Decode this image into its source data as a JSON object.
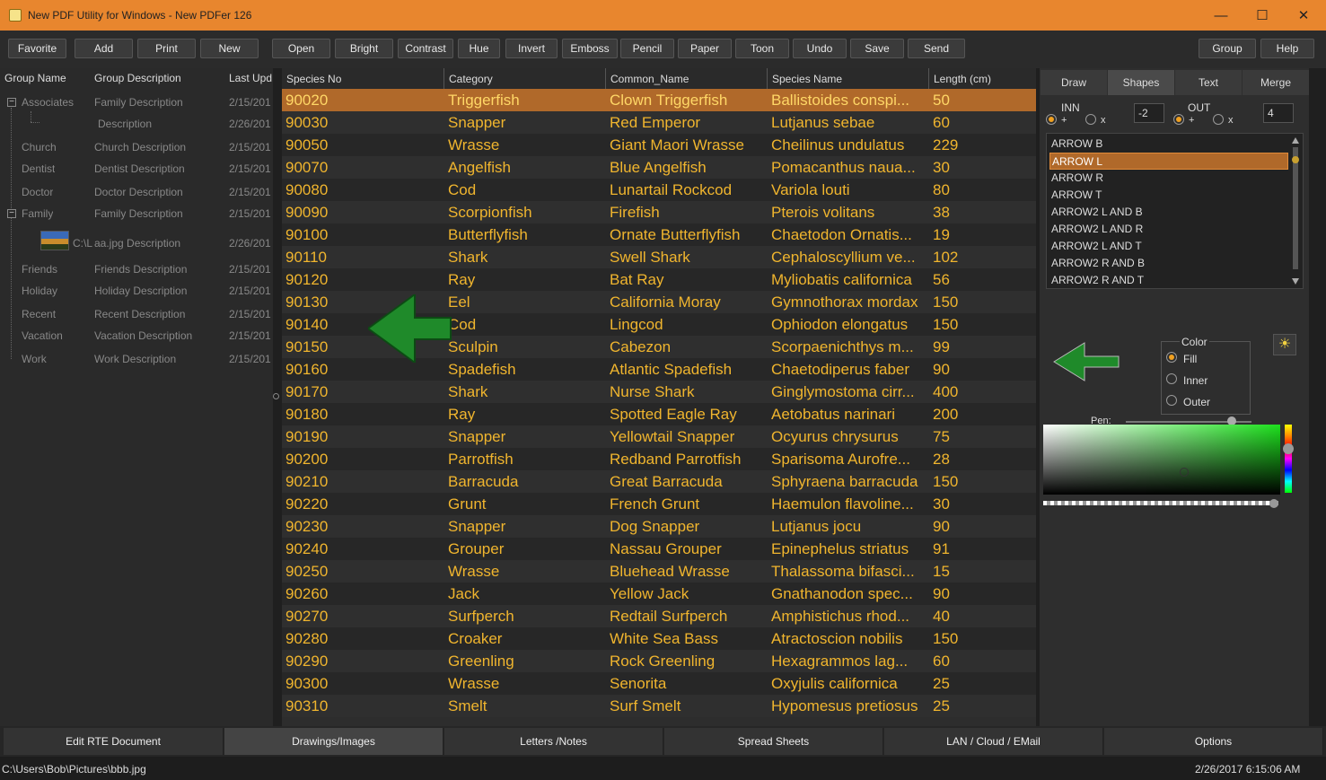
{
  "window": {
    "title": "New PDF Utility for Windows - New PDFer 126"
  },
  "toolbar": {
    "buttons": [
      "Favorite",
      "Add",
      "Print",
      "New",
      "Open",
      "Bright",
      "Contrast",
      "Hue",
      "Invert",
      "Emboss",
      "Pencil",
      "Paper",
      "Toon",
      "Undo",
      "Save",
      "Send"
    ],
    "right_buttons": [
      "Group",
      "Help"
    ]
  },
  "groups": {
    "headers": [
      "Group Name",
      "Group Description",
      "Last Upd"
    ],
    "rows": [
      {
        "name": "Associates",
        "desc": "Family Description",
        "date": "2/15/201"
      },
      {
        "name": "",
        "desc": "Description",
        "date": "2/26/201"
      },
      {
        "name": "Church",
        "desc": "Church Description",
        "date": "2/15/201"
      },
      {
        "name": "Dentist",
        "desc": "Dentist Description",
        "date": "2/15/201"
      },
      {
        "name": "Doctor",
        "desc": "Doctor Description",
        "date": "2/15/201"
      },
      {
        "name": "Family",
        "desc": "Family Description",
        "date": "2/15/201"
      },
      {
        "name": "C:\\L",
        "desc": "aa.jpg Description",
        "date": "2/26/201"
      },
      {
        "name": "Friends",
        "desc": "Friends Description",
        "date": "2/15/201"
      },
      {
        "name": "Holiday",
        "desc": "Holiday Description",
        "date": "2/15/201"
      },
      {
        "name": "Recent",
        "desc": "Recent Description",
        "date": "2/15/201"
      },
      {
        "name": "Vacation",
        "desc": "Vacation Description",
        "date": "2/15/201"
      },
      {
        "name": "Work",
        "desc": "Work Description",
        "date": "2/15/201"
      }
    ]
  },
  "grid": {
    "headers": [
      "Species No",
      "Category",
      "Common_Name",
      "Species Name",
      "Length (cm)"
    ],
    "rows": [
      [
        "90020",
        "Triggerfish",
        "Clown Triggerfish",
        "Ballistoides conspi...",
        "50"
      ],
      [
        "90030",
        "Snapper",
        "Red Emperor",
        "Lutjanus sebae",
        "60"
      ],
      [
        "90050",
        "Wrasse",
        "Giant Maori Wrasse",
        "Cheilinus undulatus",
        "229"
      ],
      [
        "90070",
        "Angelfish",
        "Blue Angelfish",
        "Pomacanthus naua...",
        "30"
      ],
      [
        "90080",
        "Cod",
        "Lunartail Rockcod",
        "Variola louti",
        "80"
      ],
      [
        "90090",
        "Scorpionfish",
        "Firefish",
        "Pterois volitans",
        "38"
      ],
      [
        "90100",
        "Butterflyfish",
        "Ornate Butterflyfish",
        "Chaetodon Ornatis...",
        "19"
      ],
      [
        "90110",
        "Shark",
        "Swell Shark",
        "Cephaloscyllium ve...",
        "102"
      ],
      [
        "90120",
        "Ray",
        "Bat Ray",
        "Myliobatis californica",
        "56"
      ],
      [
        "90130",
        "Eel",
        "California Moray",
        "Gymnothorax mordax",
        "150"
      ],
      [
        "90140",
        "Cod",
        "Lingcod",
        "Ophiodon elongatus",
        "150"
      ],
      [
        "90150",
        "Sculpin",
        "Cabezon",
        "Scorpaenichthys m...",
        "99"
      ],
      [
        "90160",
        "Spadefish",
        "Atlantic Spadefish",
        "Chaetodiperus faber",
        "90"
      ],
      [
        "90170",
        "Shark",
        "Nurse Shark",
        "Ginglymostoma cirr...",
        "400"
      ],
      [
        "90180",
        "Ray",
        "Spotted Eagle Ray",
        "Aetobatus narinari",
        "200"
      ],
      [
        "90190",
        "Snapper",
        "Yellowtail Snapper",
        "Ocyurus chrysurus",
        "75"
      ],
      [
        "90200",
        "Parrotfish",
        "Redband Parrotfish",
        "Sparisoma Aurofre...",
        "28"
      ],
      [
        "90210",
        "Barracuda",
        "Great Barracuda",
        "Sphyraena barracuda",
        "150"
      ],
      [
        "90220",
        "Grunt",
        "French Grunt",
        "Haemulon flavoline...",
        "30"
      ],
      [
        "90230",
        "Snapper",
        "Dog Snapper",
        "Lutjanus jocu",
        "90"
      ],
      [
        "90240",
        "Grouper",
        "Nassau Grouper",
        "Epinephelus striatus",
        "91"
      ],
      [
        "90250",
        "Wrasse",
        "Bluehead Wrasse",
        "Thalassoma bifasci...",
        "15"
      ],
      [
        "90260",
        "Jack",
        "Yellow Jack",
        "Gnathanodon spec...",
        "90"
      ],
      [
        "90270",
        "Surfperch",
        "Redtail Surfperch",
        "Amphistichus rhod...",
        "40"
      ],
      [
        "90280",
        "Croaker",
        "White Sea Bass",
        "Atractoscion nobilis",
        "150"
      ],
      [
        "90290",
        "Greenling",
        "Rock Greenling",
        "Hexagrammos lag...",
        "60"
      ],
      [
        "90300",
        "Wrasse",
        "Senorita",
        "Oxyjulis californica",
        "25"
      ],
      [
        "90310",
        "Smelt",
        "Surf Smelt",
        "Hypomesus pretiosus",
        "25"
      ]
    ]
  },
  "right_panel": {
    "tabs": [
      "Draw",
      "Shapes",
      "Text",
      "Merge"
    ],
    "inn_label": "INN",
    "out_label": "OUT",
    "plus": "+",
    "x": "x",
    "inn_value": "-2",
    "out_value": "4",
    "shapes": [
      "ARROW B",
      "ARROW L",
      "ARROW R",
      "ARROW T",
      "ARROW2 L AND B",
      "ARROW2 L AND R",
      "ARROW2 L AND T",
      "ARROW2 R AND B",
      "ARROW2 R AND T"
    ],
    "color_group": "Color",
    "color_options": [
      "Fill",
      "Inner",
      "Outer"
    ],
    "pen_label": "Pen:"
  },
  "bottom_tabs": [
    "Edit RTE Document",
    "Drawings/Images",
    "Letters /Notes",
    "Spread Sheets",
    "LAN / Cloud / EMail",
    "Options"
  ],
  "status": {
    "path": "C:\\Users\\Bob\\Pictures\\bbb.jpg",
    "datetime": "2/26/2017 6:15:06 AM"
  },
  "colors": {
    "titlebar": "#e8862e",
    "selection": "#b0692a",
    "grid_text": "#f0b52e",
    "arrow_green": "#1f8a2a"
  }
}
